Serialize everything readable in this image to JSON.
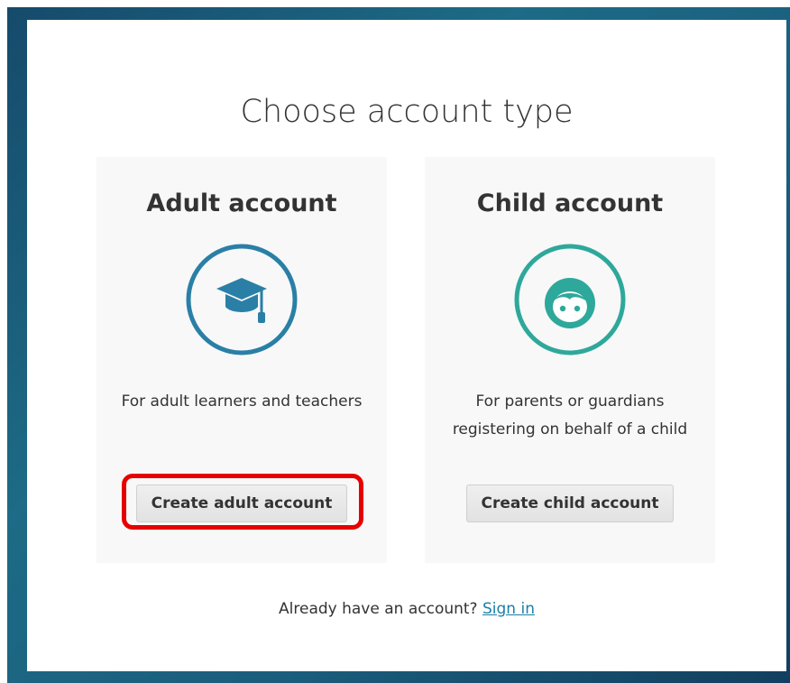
{
  "page": {
    "title": "Choose account type"
  },
  "adult": {
    "heading": "Adult account",
    "icon": "graduation-cap-icon",
    "icon_color": "#2a7fa6",
    "description": "For adult learners and teachers",
    "button_label": "Create adult account"
  },
  "child": {
    "heading": "Child account",
    "icon": "child-face-icon",
    "icon_color": "#2ea89a",
    "description": "For parents or guardians registering on behalf of a child",
    "button_label": "Create child account"
  },
  "footer": {
    "prompt": "Already have an account?",
    "signin_label": "Sign in",
    "link_color": "#1a7fa8"
  },
  "annotation": {
    "highlight_color": "#e60000"
  }
}
